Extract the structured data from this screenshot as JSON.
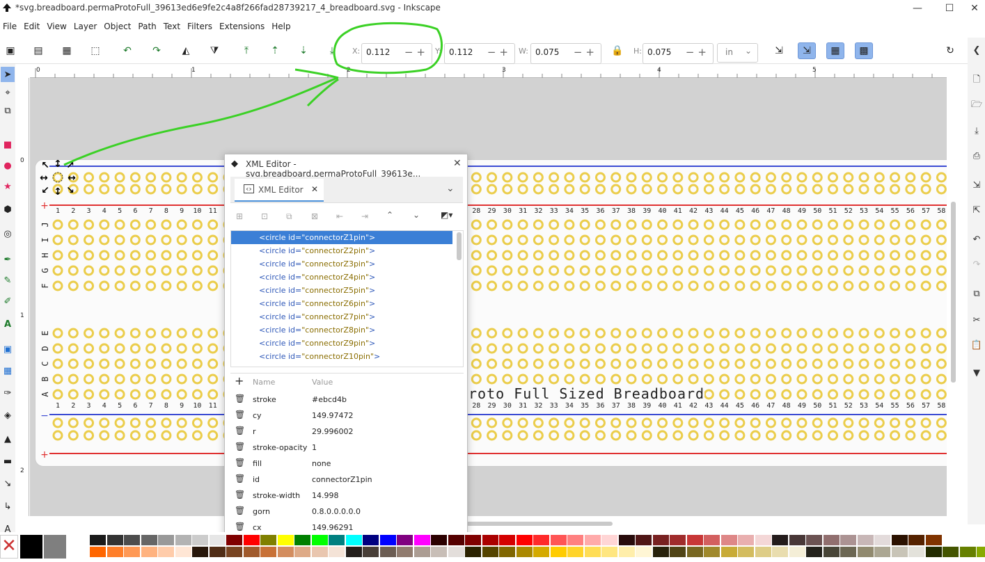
{
  "window": {
    "title": "*svg.breadboard.permaProtoFull_39613ed6e9fe2c4a8f266fad28739217_4_breadboard.svg - Inkscape",
    "min": "—",
    "max": "☐",
    "close": "✕"
  },
  "menu": [
    "File",
    "Edit",
    "View",
    "Layer",
    "Object",
    "Path",
    "Text",
    "Filters",
    "Extensions",
    "Help"
  ],
  "toolbar": {
    "x_label": "X:",
    "x_value": "0.112",
    "y_label": "Y:",
    "y_value": "0.112",
    "w_label": "W:",
    "w_value": "0.075",
    "h_label": "H:",
    "h_value": "0.075",
    "unit": "in",
    "minus": "−",
    "plus": "+"
  },
  "ruler": {
    "h_ticks": [
      "0",
      "1",
      "2",
      "3",
      "4",
      "5"
    ],
    "v_ticks": [
      "0",
      "1",
      "2"
    ]
  },
  "board": {
    "title": "Perma-Proto Full Sized Breadboard",
    "visible_title": "roto Full Sized Breadboard",
    "row_letters_top": [
      "J",
      "I",
      "H",
      "G",
      "F"
    ],
    "row_letters_bottom": [
      "E",
      "D",
      "C",
      "B",
      "A"
    ],
    "plus": "+",
    "minus": "−",
    "columns": 58,
    "hole_color": "#ebcd4b",
    "rail_blue": "#3b4bd3",
    "rail_red": "#e03131"
  },
  "xml_editor": {
    "title": "XML Editor - svg.breadboard.permaProtoFull_39613e...",
    "tab_label": "XML Editor",
    "nodes": [
      {
        "tag": "<circle",
        "attr": "id=",
        "value": "\"connectorZ1pin\"",
        "end": ">"
      },
      {
        "tag": "<circle",
        "attr": "id=",
        "value": "\"connectorZ2pin\"",
        "end": ">"
      },
      {
        "tag": "<circle",
        "attr": "id=",
        "value": "\"connectorZ3pin\"",
        "end": ">"
      },
      {
        "tag": "<circle",
        "attr": "id=",
        "value": "\"connectorZ4pin\"",
        "end": ">"
      },
      {
        "tag": "<circle",
        "attr": "id=",
        "value": "\"connectorZ5pin\"",
        "end": ">"
      },
      {
        "tag": "<circle",
        "attr": "id=",
        "value": "\"connectorZ6pin\"",
        "end": ">"
      },
      {
        "tag": "<circle",
        "attr": "id=",
        "value": "\"connectorZ7pin\"",
        "end": ">"
      },
      {
        "tag": "<circle",
        "attr": "id=",
        "value": "\"connectorZ8pin\"",
        "end": ">"
      },
      {
        "tag": "<circle",
        "attr": "id=",
        "value": "\"connectorZ9pin\"",
        "end": ">"
      },
      {
        "tag": "<circle",
        "attr": "id=",
        "value": "\"connectorZ10pin\"",
        "end": ">"
      }
    ],
    "attr_header": {
      "name": "Name",
      "value": "Value"
    },
    "attributes": [
      {
        "name": "stroke",
        "value": "#ebcd4b"
      },
      {
        "name": "cy",
        "value": "149.97472"
      },
      {
        "name": "r",
        "value": "29.996002"
      },
      {
        "name": "stroke-opacity",
        "value": "1"
      },
      {
        "name": "fill",
        "value": "none"
      },
      {
        "name": "id",
        "value": "connectorZ1pin"
      },
      {
        "name": "stroke-width",
        "value": "14.998"
      },
      {
        "name": "gorn",
        "value": "0.8.0.0.0.0.0"
      },
      {
        "name": "cx",
        "value": "149.96291"
      }
    ]
  },
  "palette": [
    "#000000",
    "#7f7f7f",
    "#ffffff",
    "#1a1a1a",
    "#333333",
    "#4d4d4d",
    "#666666",
    "#999999",
    "#b3b3b3",
    "#cccccc",
    "#e6e6e6",
    "#800000",
    "#ff0000",
    "#808000",
    "#ffff00",
    "#008000",
    "#00ff00",
    "#008080",
    "#00ffff",
    "#000080",
    "#0000ff",
    "#800080",
    "#ff00ff",
    "#2b0000",
    "#550000",
    "#800000",
    "#aa0000",
    "#d40000",
    "#ff0000",
    "#ff2a2a",
    "#ff5555",
    "#ff8080",
    "#ffaaaa",
    "#ffd5d5",
    "#280b0b",
    "#501616",
    "#782121",
    "#a02c2c",
    "#c83737",
    "#d35f5f",
    "#de8787",
    "#e9afaf",
    "#f4d7d7",
    "#241c1c",
    "#483737",
    "#6c5353",
    "#916f6f",
    "#ac9393",
    "#c8b7b7",
    "#e3dbdb",
    "#2b1100",
    "#552200",
    "#803300"
  ],
  "palette_bottom": [
    "#ff6600",
    "#ff7f2a",
    "#ff9955",
    "#ffb380",
    "#ffccaa",
    "#ffe6d5",
    "#28170b",
    "#502d16",
    "#784421",
    "#a05a2c",
    "#c87137",
    "#d38d5f",
    "#deaa87",
    "#e9c6af",
    "#f4e3d7",
    "#241f1c",
    "#483e37",
    "#6c5d53",
    "#917c6f",
    "#ac9d93",
    "#c8beb7",
    "#e3dedb",
    "#2b2200",
    "#554400",
    "#806600",
    "#aa8800",
    "#d4aa00",
    "#ffcc00",
    "#ffd42a",
    "#ffdd55",
    "#ffe680",
    "#ffeeaa",
    "#fff6d5",
    "#28220b",
    "#504416",
    "#786721",
    "#a0892c",
    "#c8ab37",
    "#d3bc5f",
    "#decd87",
    "#e9ddaf",
    "#f4eed7",
    "#24221c",
    "#484537",
    "#6c6753",
    "#918a6f",
    "#aca793",
    "#c8c4b7",
    "#e3e2db",
    "#222b00",
    "#445500",
    "#668000",
    "#88aa00"
  ],
  "annotation": {
    "color": "#3bd125"
  }
}
